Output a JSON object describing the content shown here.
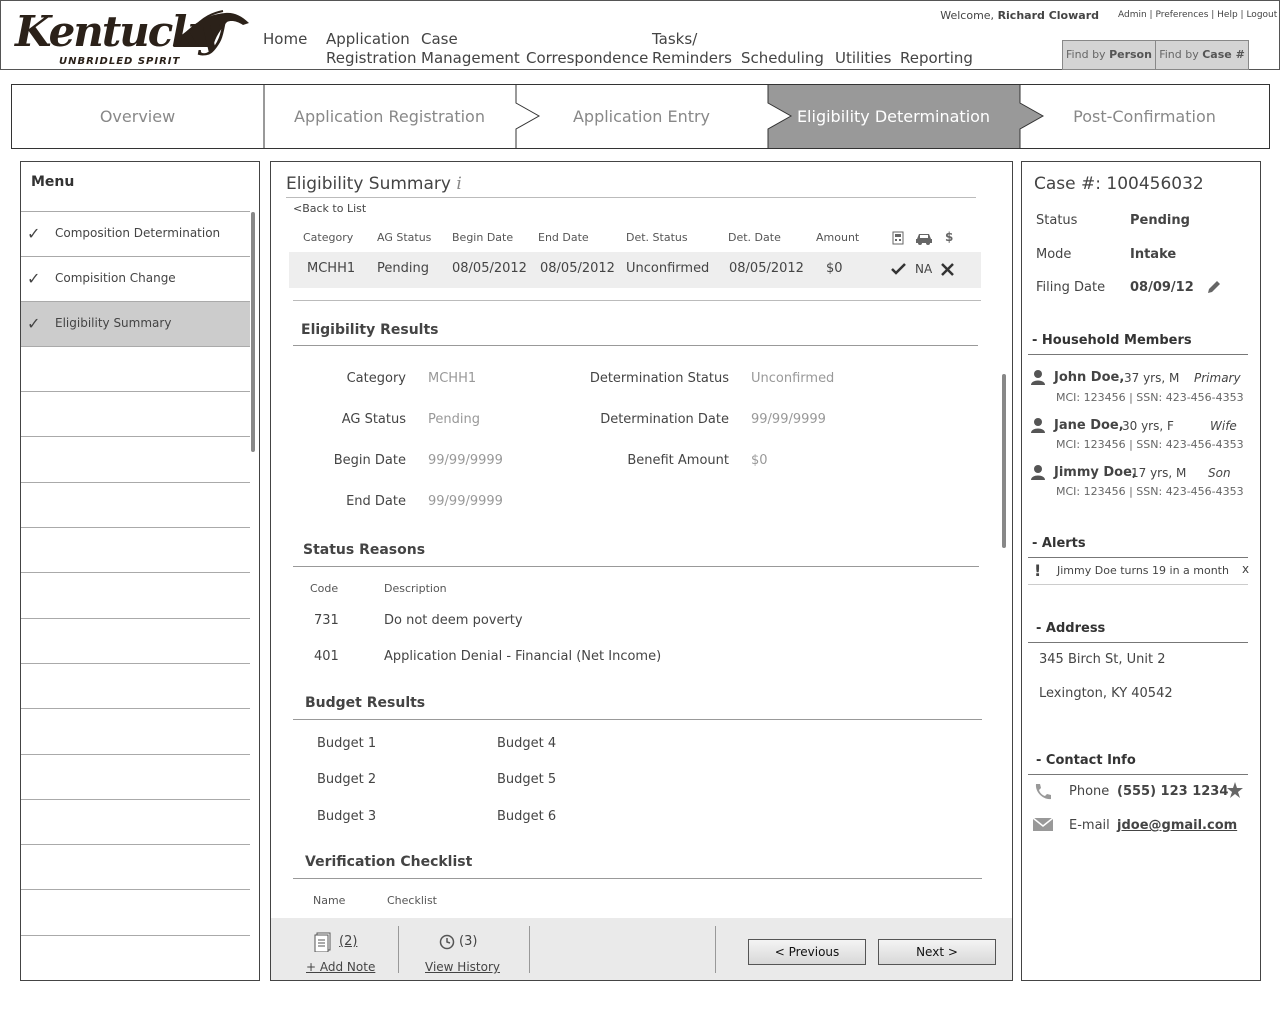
{
  "brand": {
    "logo_word": "Kentucky",
    "logo_tagline": "UNBRIDLED SPIRIT"
  },
  "header": {
    "welcome_prefix": "Welcome,",
    "user_name": "Richard Cloward",
    "links": [
      "Admin",
      "Preferences",
      "Help",
      "Logout"
    ],
    "nav": [
      {
        "line1": "",
        "line2": "Home"
      },
      {
        "line1": "Application",
        "line2": "Registration"
      },
      {
        "line1": "Case",
        "line2": "Management"
      },
      {
        "line1": "",
        "line2": "Correspondence"
      },
      {
        "line1": "Tasks/",
        "line2": "Reminders"
      },
      {
        "line1": "",
        "line2": "Scheduling"
      },
      {
        "line1": "",
        "line2": "Utilities"
      },
      {
        "line1": "",
        "line2": "Reporting"
      }
    ],
    "find_by_prefix": "Find by",
    "find_person": "Person",
    "find_case": "Case #"
  },
  "steps": [
    "Overview",
    "Application Registration",
    "Application Entry",
    "Eligibility Determination",
    "Post-Confirmation"
  ],
  "active_step": "Eligibility Determination",
  "menu": {
    "title": "Menu",
    "items": [
      {
        "label": "Composition Determination",
        "checked": true
      },
      {
        "label": "Compisition Change",
        "checked": true
      },
      {
        "label": "Eligibility Summary",
        "checked": true,
        "selected": true
      }
    ]
  },
  "main": {
    "title": "Eligibility Summary",
    "info_glyph": "i",
    "back_link": "<Back to List",
    "table": {
      "headers": [
        "Category",
        "AG Status",
        "Begin Date",
        "End Date",
        "Det. Status",
        "Det. Date",
        "Amount"
      ],
      "row": [
        "MCHH1",
        "Pending",
        "08/05/2012",
        "08/05/2012",
        "Unconfirmed",
        "08/05/2012",
        "$0"
      ],
      "row_na": "NA",
      "header_icons": [
        "calculator-icon",
        "car-icon",
        "dollar-icon"
      ],
      "dollar_glyph": "$"
    },
    "results": {
      "title": "Eligibility Results",
      "left": [
        {
          "label": "Category",
          "value": "MCHH1"
        },
        {
          "label": "AG Status",
          "value": "Pending"
        },
        {
          "label": "Begin Date",
          "value": "99/99/9999"
        },
        {
          "label": "End Date",
          "value": "99/99/9999"
        }
      ],
      "right": [
        {
          "label": "Determination Status",
          "value": "Unconfirmed"
        },
        {
          "label": "Determination Date",
          "value": "99/99/9999"
        },
        {
          "label": "Benefit Amount",
          "value": "$0"
        }
      ]
    },
    "status_reasons": {
      "title": "Status Reasons",
      "headers": [
        "Code",
        "Description"
      ],
      "rows": [
        {
          "code": "731",
          "desc": "Do not deem poverty"
        },
        {
          "code": "401",
          "desc": "Application Denial - Financial (Net Income)"
        }
      ]
    },
    "budget": {
      "title": "Budget Results",
      "items": [
        "Budget 1",
        "Budget 2",
        "Budget 3",
        "Budget 4",
        "Budget 5",
        "Budget 6"
      ]
    },
    "verification": {
      "title": "Verification Checklist",
      "headers": [
        "Name",
        "Checklist"
      ]
    },
    "footer": {
      "notes_count": "(2)",
      "add_note": "+ Add Note",
      "history_count": "(3)",
      "view_history": "View History",
      "previous": "< Previous",
      "next": "Next >"
    }
  },
  "side": {
    "case_label": "Case #: 100456032",
    "fields": [
      {
        "label": "Status",
        "value": "Pending"
      },
      {
        "label": "Mode",
        "value": "Intake"
      },
      {
        "label": "Filing Date",
        "value": "08/09/12"
      }
    ],
    "household_title": "- Household Members",
    "members": [
      {
        "name": "John Doe,",
        "info": "37 yrs,   M",
        "role": "Primary",
        "ids": "MCI: 123456 | SSN: 423-456-4353"
      },
      {
        "name": "Jane Doe,",
        "info": "30 yrs,   F",
        "role": "Wife",
        "ids": "MCI: 123456 | SSN: 423-456-4353"
      },
      {
        "name": "Jimmy Doe,",
        "info": "17 yrs,  M",
        "role": "Son",
        "ids": "MCI: 123456 | SSN: 423-456-4353"
      }
    ],
    "alerts_title": "- Alerts",
    "alert": "Jimmy Doe turns 19 in a month",
    "alert_mark": "!",
    "alert_close": "x",
    "address_title": "- Address",
    "address_line1": "345 Birch St, Unit 2",
    "address_line2": "Lexington, KY 40542",
    "contact_title": "- Contact Info",
    "phone_label": "Phone",
    "phone": "(555) 123 1234",
    "email_label": "E-mail",
    "email": "jdoe@gmail.com"
  }
}
